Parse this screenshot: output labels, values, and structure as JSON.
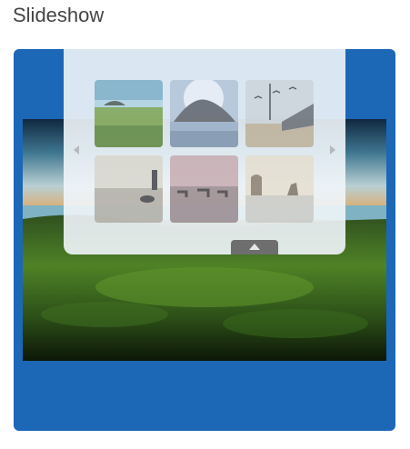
{
  "page": {
    "title": "Slideshow"
  },
  "slideshow": {
    "accent_color": "#1c67b6",
    "current_slide": "coastal-meadow",
    "thumbnails": [
      {
        "name": "island-meadow"
      },
      {
        "name": "rock-sunburst"
      },
      {
        "name": "birds-pier"
      },
      {
        "name": "walker-dog-beach"
      },
      {
        "name": "horse-riders-beach"
      },
      {
        "name": "sea-stacks-sunset"
      }
    ],
    "controls": {
      "prev_icon": "chevron-left-icon",
      "next_icon": "chevron-right-icon",
      "toggle_icon": "chevron-up-icon"
    }
  }
}
